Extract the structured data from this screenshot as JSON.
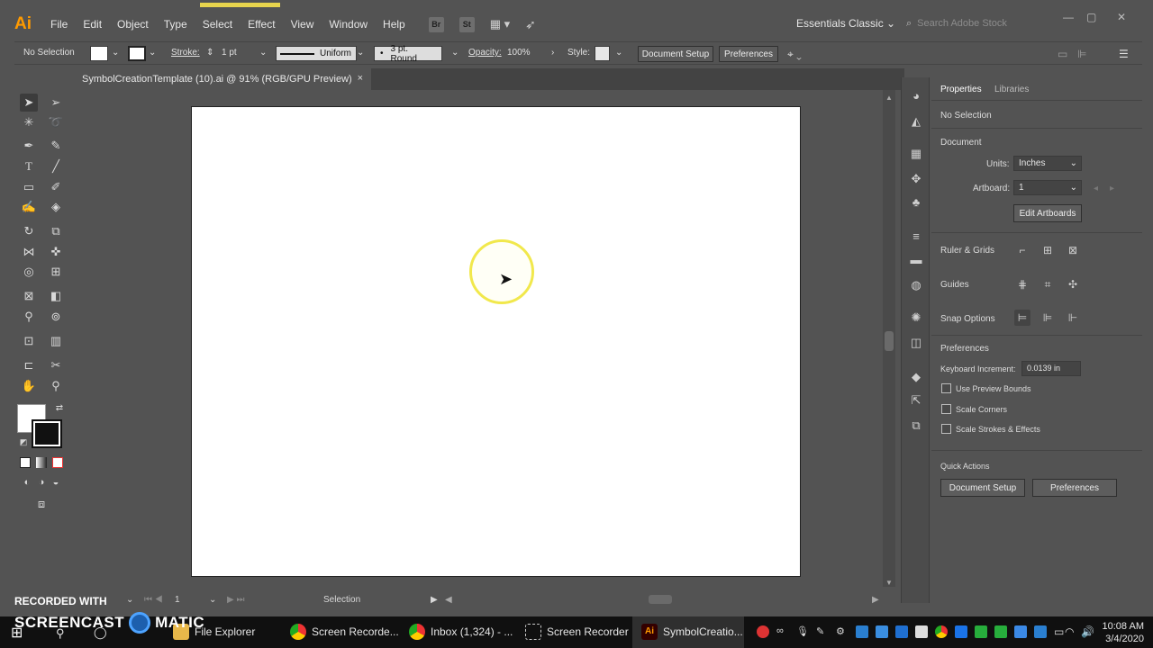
{
  "app": {
    "logo": "Ai",
    "accent": "#ff9a00"
  },
  "menu": {
    "items": [
      "File",
      "Edit",
      "Object",
      "Type",
      "Select",
      "Effect",
      "View",
      "Window",
      "Help"
    ],
    "bridge_icon": "Br",
    "stock_icon": "St",
    "workspace": "Essentials Classic",
    "search_placeholder": "Search Adobe Stock"
  },
  "control_bar": {
    "selection": "No Selection",
    "stroke_label": "Stroke:",
    "stroke_value": "1 pt",
    "profile": "Uniform",
    "brush": "3 pt. Round",
    "opacity_label": "Opacity:",
    "opacity_value": "100%",
    "style_label": "Style:",
    "document_setup": "Document Setup",
    "preferences": "Preferences"
  },
  "document": {
    "tab_title": "SymbolCreationTemplate (10).ai @ 91% (RGB/GPU Preview)",
    "close": "×"
  },
  "status": {
    "zoom_value": "1",
    "tool_name": "Selection"
  },
  "properties": {
    "tabs": [
      "Properties",
      "Libraries"
    ],
    "no_selection": "No Selection",
    "document_heading": "Document",
    "units_label": "Units:",
    "units_value": "Inches",
    "artboard_label": "Artboard:",
    "artboard_value": "1",
    "edit_artboards": "Edit Artboards",
    "ruler_grids": "Ruler & Grids",
    "guides": "Guides",
    "snap_options": "Snap Options",
    "preferences_heading": "Preferences",
    "keyboard_increment_label": "Keyboard Increment:",
    "keyboard_increment_value": "0.0139 in",
    "use_preview_bounds": "Use Preview Bounds",
    "scale_corners": "Scale Corners",
    "scale_strokes": "Scale Strokes & Effects",
    "quick_actions": "Quick Actions",
    "qa_document_setup": "Document Setup",
    "qa_preferences": "Preferences"
  },
  "watermark": {
    "line1": "RECORDED WITH",
    "line2a": "SCREENCAST",
    "line2b": "MATIC"
  },
  "taskbar": {
    "items": [
      "File Explorer",
      "Screen Recorde...",
      "Inbox (1,324) - ...",
      "Screen Recorder",
      "SymbolCreatio..."
    ],
    "time": "10:08 AM",
    "date": "3/4/2020"
  }
}
